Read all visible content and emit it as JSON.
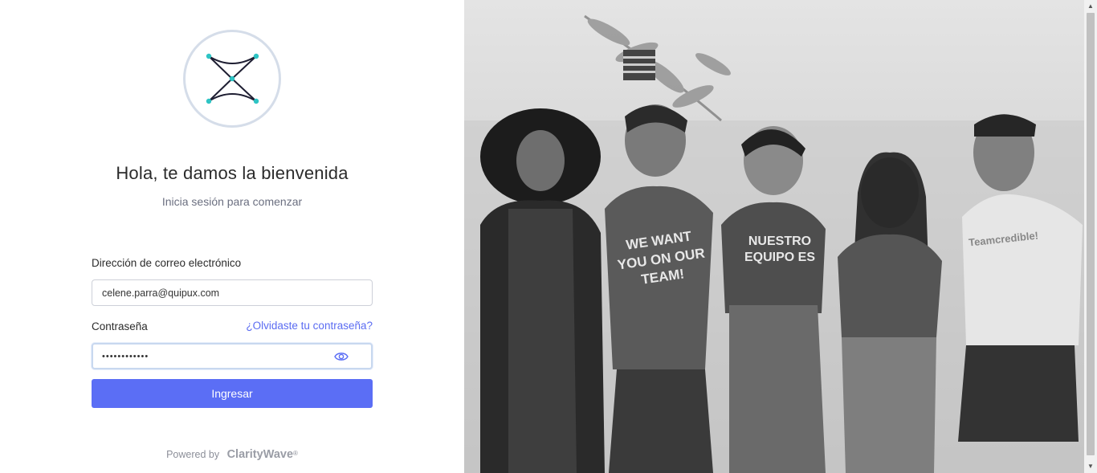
{
  "login": {
    "title": "Hola, te damos la bienvenida",
    "subtitle": "Inicia sesión para comenzar",
    "email_label": "Dirección de correo electrónico",
    "email_value": "celene.parra@quipux.com",
    "password_label": "Contraseña",
    "forgot_link": "¿Olvidaste tu contraseña?",
    "password_value": "••••••••••••",
    "submit_label": "Ingresar",
    "powered_by": "Powered by",
    "brand": "ClarityWave",
    "brand_mark": "®"
  },
  "photo": {
    "shirt_texts": [
      "WE WANT",
      "YOU ON OUR",
      "TEAM!",
      "NUESTRO",
      "EQUIPO ES",
      "Teamcredible!"
    ]
  },
  "icons": {
    "logo": "x-logo-icon",
    "eye": "eye-icon",
    "scroll_up": "chevron-up-icon",
    "scroll_down": "chevron-down-icon"
  },
  "colors": {
    "accent": "#5b6ef5",
    "link": "#5b6cf2",
    "logo_teal": "#2ec4c4",
    "logo_ring": "#d5dde9"
  }
}
